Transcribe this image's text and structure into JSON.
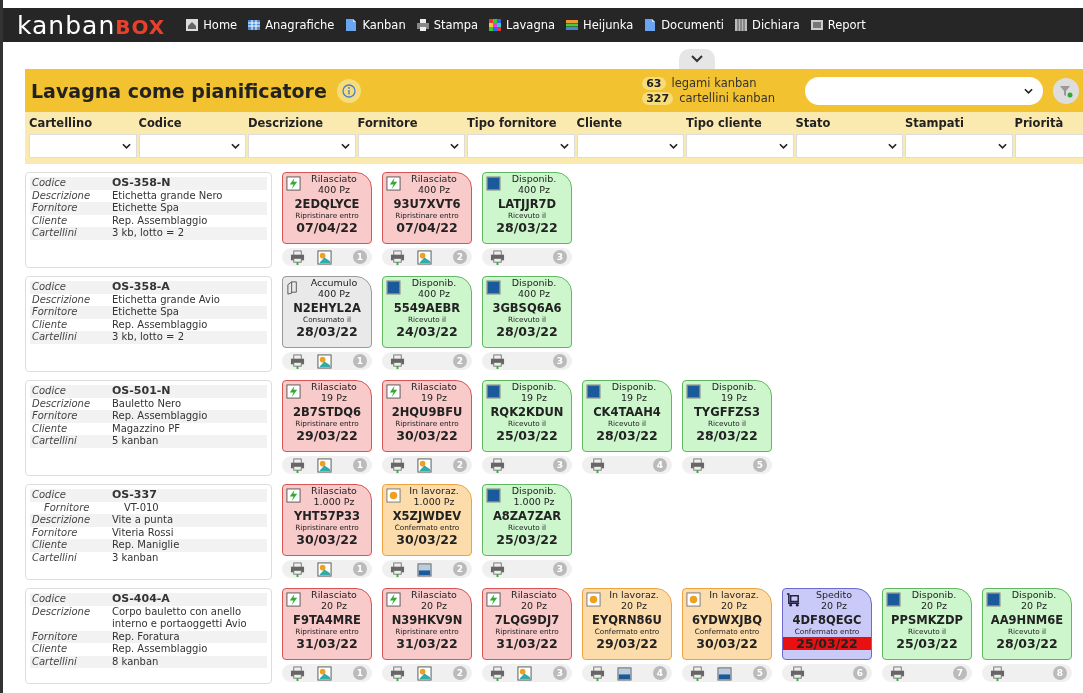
{
  "logo": {
    "main": "kanban",
    "accent": "BOX"
  },
  "nav": [
    {
      "label": "Home",
      "kind": "house"
    },
    {
      "label": "Anagrafiche",
      "kind": "table"
    },
    {
      "label": "Kanban",
      "kind": "doc"
    },
    {
      "label": "Stampa",
      "kind": "printer"
    },
    {
      "label": "Lavagna",
      "kind": "grid"
    },
    {
      "label": "Heijunka",
      "kind": "bars"
    },
    {
      "label": "Documenti",
      "kind": "doc"
    },
    {
      "label": "Dichiara",
      "kind": "book"
    },
    {
      "label": "Report",
      "kind": "panel"
    }
  ],
  "header": {
    "title": "Lavagna come pianificatore",
    "counters": [
      {
        "count": "63",
        "label": "legami kanban"
      },
      {
        "count": "327",
        "label": "cartellini kanban"
      }
    ]
  },
  "filters": [
    "Cartellino",
    "Codice",
    "Descrizione",
    "Fornitore",
    "Tipo fornitore",
    "Cliente",
    "Tipo cliente",
    "Stato",
    "Stampati",
    "Priorità"
  ],
  "rows": [
    {
      "info": [
        {
          "kind": "code",
          "label": "Codice",
          "value": "OS-358-N"
        },
        {
          "kind": "field",
          "label": "Descrizione",
          "value": "Etichetta grande Nero"
        },
        {
          "kind": "field",
          "label": "Fornitore",
          "value": "Etichette Spa"
        },
        {
          "kind": "field",
          "label": "Cliente",
          "value": "Rep. Assemblaggio"
        },
        {
          "kind": "field",
          "label": "Cartellini",
          "value": "3 kb, lotto = 2"
        }
      ],
      "cards": [
        {
          "kind": "released",
          "status": "Rilasciato",
          "qty": "400 Pz",
          "code": "2EDQLYCE",
          "note": "Ripristinare entro",
          "date": "07/04/22",
          "overdue": false,
          "number": "1",
          "tool": {
            "kind": "reorder"
          }
        },
        {
          "kind": "released",
          "status": "Rilasciato",
          "qty": "400 Pz",
          "code": "93U7XVT6",
          "note": "Ripristinare entro",
          "date": "07/04/22",
          "overdue": false,
          "number": "2",
          "tool": {
            "kind": "reorder"
          }
        },
        {
          "kind": "available",
          "status": "Disponib.",
          "qty": "400 Pz",
          "code": "LATJJR7D",
          "note": "Ricevuto il",
          "date": "28/03/22",
          "overdue": false,
          "number": "3"
        }
      ]
    },
    {
      "info": [
        {
          "kind": "code",
          "label": "Codice",
          "value": "OS-358-A"
        },
        {
          "kind": "field",
          "label": "Descrizione",
          "value": "Etichetta grande Avio"
        },
        {
          "kind": "field",
          "label": "Fornitore",
          "value": "Etichette Spa"
        },
        {
          "kind": "field",
          "label": "Cliente",
          "value": "Rep. Assemblaggio"
        },
        {
          "kind": "field",
          "label": "Cartellini",
          "value": "3 kb, lotto = 2"
        }
      ],
      "cards": [
        {
          "kind": "accumulating",
          "status": "Accumulo",
          "qty": "400 Pz",
          "code": "N2EHYL2A",
          "note": "Consumato il",
          "date": "28/03/22",
          "overdue": false,
          "number": "1",
          "tool": {
            "kind": "reorder"
          }
        },
        {
          "kind": "available",
          "status": "Disponib.",
          "qty": "400 Pz",
          "code": "5549AEBR",
          "note": "Ricevuto il",
          "date": "24/03/22",
          "overdue": false,
          "number": "2"
        },
        {
          "kind": "available",
          "status": "Disponib.",
          "qty": "400 Pz",
          "code": "3GBSQ6A6",
          "note": "Ricevuto il",
          "date": "28/03/22",
          "overdue": false,
          "number": "3"
        }
      ]
    },
    {
      "info": [
        {
          "kind": "code",
          "label": "Codice",
          "value": "OS-501-N"
        },
        {
          "kind": "field",
          "label": "Descrizione",
          "value": "Bauletto Nero"
        },
        {
          "kind": "field",
          "label": "Fornitore",
          "value": "Rep. Assemblaggio"
        },
        {
          "kind": "field",
          "label": "Cliente",
          "value": "Magazzino PF"
        },
        {
          "kind": "field",
          "label": "Cartellini",
          "value": "5 kanban"
        }
      ],
      "cards": [
        {
          "kind": "released",
          "status": "Rilasciato",
          "qty": "19 Pz",
          "code": "2B7STDQ6",
          "note": "Ripristinare entro",
          "date": "29/03/22",
          "overdue": false,
          "number": "1",
          "tool": {
            "kind": "reorder"
          }
        },
        {
          "kind": "released",
          "status": "Rilasciato",
          "qty": "19 Pz",
          "code": "2HQU9BFU",
          "note": "Ripristinare entro",
          "date": "30/03/22",
          "overdue": false,
          "number": "2",
          "tool": {
            "kind": "reorder"
          }
        },
        {
          "kind": "available",
          "status": "Disponib.",
          "qty": "19 Pz",
          "code": "RQK2KDUN",
          "note": "Ricevuto il",
          "date": "25/03/22",
          "overdue": false,
          "number": "3"
        },
        {
          "kind": "available",
          "status": "Disponib.",
          "qty": "19 Pz",
          "code": "CK4TAAH4",
          "note": "Ricevuto il",
          "date": "28/03/22",
          "overdue": false,
          "number": "4"
        },
        {
          "kind": "available",
          "status": "Disponib.",
          "qty": "19 Pz",
          "code": "TYGFFZS3",
          "note": "Ricevuto il",
          "date": "28/03/22",
          "overdue": false,
          "number": "5"
        }
      ]
    },
    {
      "info": [
        {
          "kind": "code",
          "label": "Codice",
          "value": "OS-337"
        },
        {
          "kind": "sub",
          "label": "Fornitore",
          "value": "VT-010"
        },
        {
          "kind": "field",
          "label": "Descrizione",
          "value": "Vite a punta"
        },
        {
          "kind": "field",
          "label": "Fornitore",
          "value": "Viteria Rossi"
        },
        {
          "kind": "field",
          "label": "Cliente",
          "value": "Rep. Maniglie"
        },
        {
          "kind": "field",
          "label": "Cartellini",
          "value": "3 kanban"
        }
      ],
      "cards": [
        {
          "kind": "released",
          "status": "Rilasciato",
          "qty": "1.000 Pz",
          "code": "YHT57P33",
          "note": "Ripristinare entro",
          "date": "30/03/22",
          "overdue": false,
          "number": "1",
          "tool": {
            "kind": "reorder"
          }
        },
        {
          "kind": "working",
          "status": "In lavoraz.",
          "qty": "1.000 Pz",
          "code": "X5ZJWDEV",
          "note": "Confermato entro",
          "date": "30/03/22",
          "overdue": false,
          "number": "2",
          "tool": {
            "kind": "tray"
          }
        },
        {
          "kind": "available",
          "status": "Disponib.",
          "qty": "1.000 Pz",
          "code": "A8ZA7ZAR",
          "note": "Ricevuto il",
          "date": "25/03/22",
          "overdue": false,
          "number": "3"
        }
      ]
    },
    {
      "info": [
        {
          "kind": "code",
          "label": "Codice",
          "value": "OS-404-A"
        },
        {
          "kind": "field",
          "label": "Descrizione",
          "value": "Corpo bauletto con anello interno e portaoggetti Avio"
        },
        {
          "kind": "field",
          "label": "Fornitore",
          "value": "Rep. Foratura"
        },
        {
          "kind": "field",
          "label": "Cliente",
          "value": "Rep. Assemblaggio"
        },
        {
          "kind": "field",
          "label": "Cartellini",
          "value": "8 kanban"
        }
      ],
      "cards": [
        {
          "kind": "released",
          "status": "Rilasciato",
          "qty": "20 Pz",
          "code": "F9TA4MRE",
          "note": "Ripristinare entro",
          "date": "31/03/22",
          "overdue": false,
          "number": "1",
          "tool": {
            "kind": "reorder"
          }
        },
        {
          "kind": "released",
          "status": "Rilasciato",
          "qty": "20 Pz",
          "code": "N39HKV9N",
          "note": "Ripristinare entro",
          "date": "31/03/22",
          "overdue": false,
          "number": "2",
          "tool": {
            "kind": "reorder"
          }
        },
        {
          "kind": "released",
          "status": "Rilasciato",
          "qty": "20 Pz",
          "code": "7LQG9DJ7",
          "note": "Ripristinare entro",
          "date": "31/03/22",
          "overdue": false,
          "number": "3",
          "tool": {
            "kind": "reorder"
          }
        },
        {
          "kind": "working",
          "status": "In lavoraz.",
          "qty": "20 Pz",
          "code": "EYQRN86U",
          "note": "Confermato entro",
          "date": "29/03/22",
          "overdue": false,
          "number": "4",
          "tool": {
            "kind": "tray"
          }
        },
        {
          "kind": "working",
          "status": "In lavoraz.",
          "qty": "20 Pz",
          "code": "6YDWXJBQ",
          "note": "Confermato entro",
          "date": "30/03/22",
          "overdue": false,
          "number": "5",
          "tool": {
            "kind": "tray"
          }
        },
        {
          "kind": "shipped",
          "status": "Spedito",
          "qty": "20 Pz",
          "code": "4DF8QEGC",
          "note": "Confermato entro",
          "date": "25/03/22",
          "overdue": true,
          "number": "6"
        },
        {
          "kind": "available",
          "status": "Disponib.",
          "qty": "20 Pz",
          "code": "PPSMKZDP",
          "note": "Ricevuto il",
          "date": "25/03/22",
          "overdue": false,
          "number": "7"
        },
        {
          "kind": "available",
          "status": "Disponib.",
          "qty": "20 Pz",
          "code": "AA9HNM6E",
          "note": "Ricevuto il",
          "date": "28/03/22",
          "overdue": false,
          "number": "8"
        }
      ]
    }
  ]
}
